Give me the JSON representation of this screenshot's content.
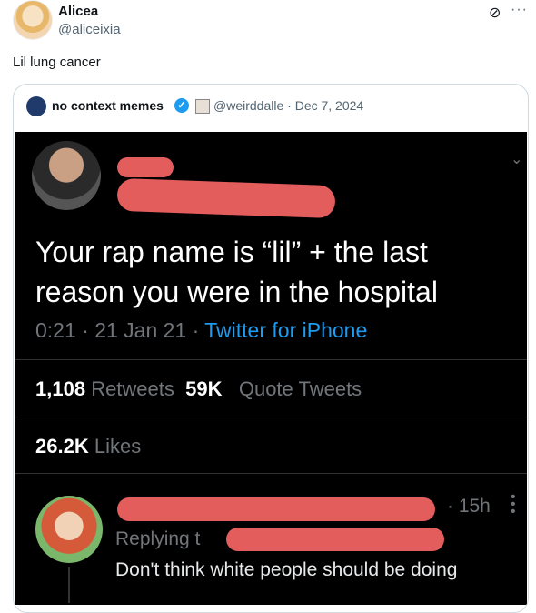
{
  "post": {
    "author_name": "Alicea",
    "author_handle": "@aliceixia",
    "text": "Lil lung cancer"
  },
  "quote": {
    "author_name": "no context memes",
    "author_handle": "@weirddalle",
    "date": "Dec 7, 2024"
  },
  "image": {
    "headline_line1": "Your rap name is “lil” + the last",
    "headline_line2": "reason you were in the hospital",
    "meta_time": "0:21 · 21 Jan 21 · ",
    "meta_source": "Twitter for iPhone",
    "retweets_count": "1,108",
    "retweets_label": "Retweets",
    "quotes_count": "59K",
    "quotes_label": "Quote Tweets",
    "likes_count": "26.2K",
    "likes_label": "Likes",
    "reply_time": "· 15h",
    "reply_replying": "Replying t",
    "reply_text": "Don't think white people should be doing"
  },
  "colors": {
    "redaction": "#e35d5d",
    "link": "#1d9bf0",
    "verified": "#1d9bf0"
  },
  "icons": {
    "grok": "grok-icon",
    "more": "more-icon",
    "verified": "verified-badge-icon"
  }
}
